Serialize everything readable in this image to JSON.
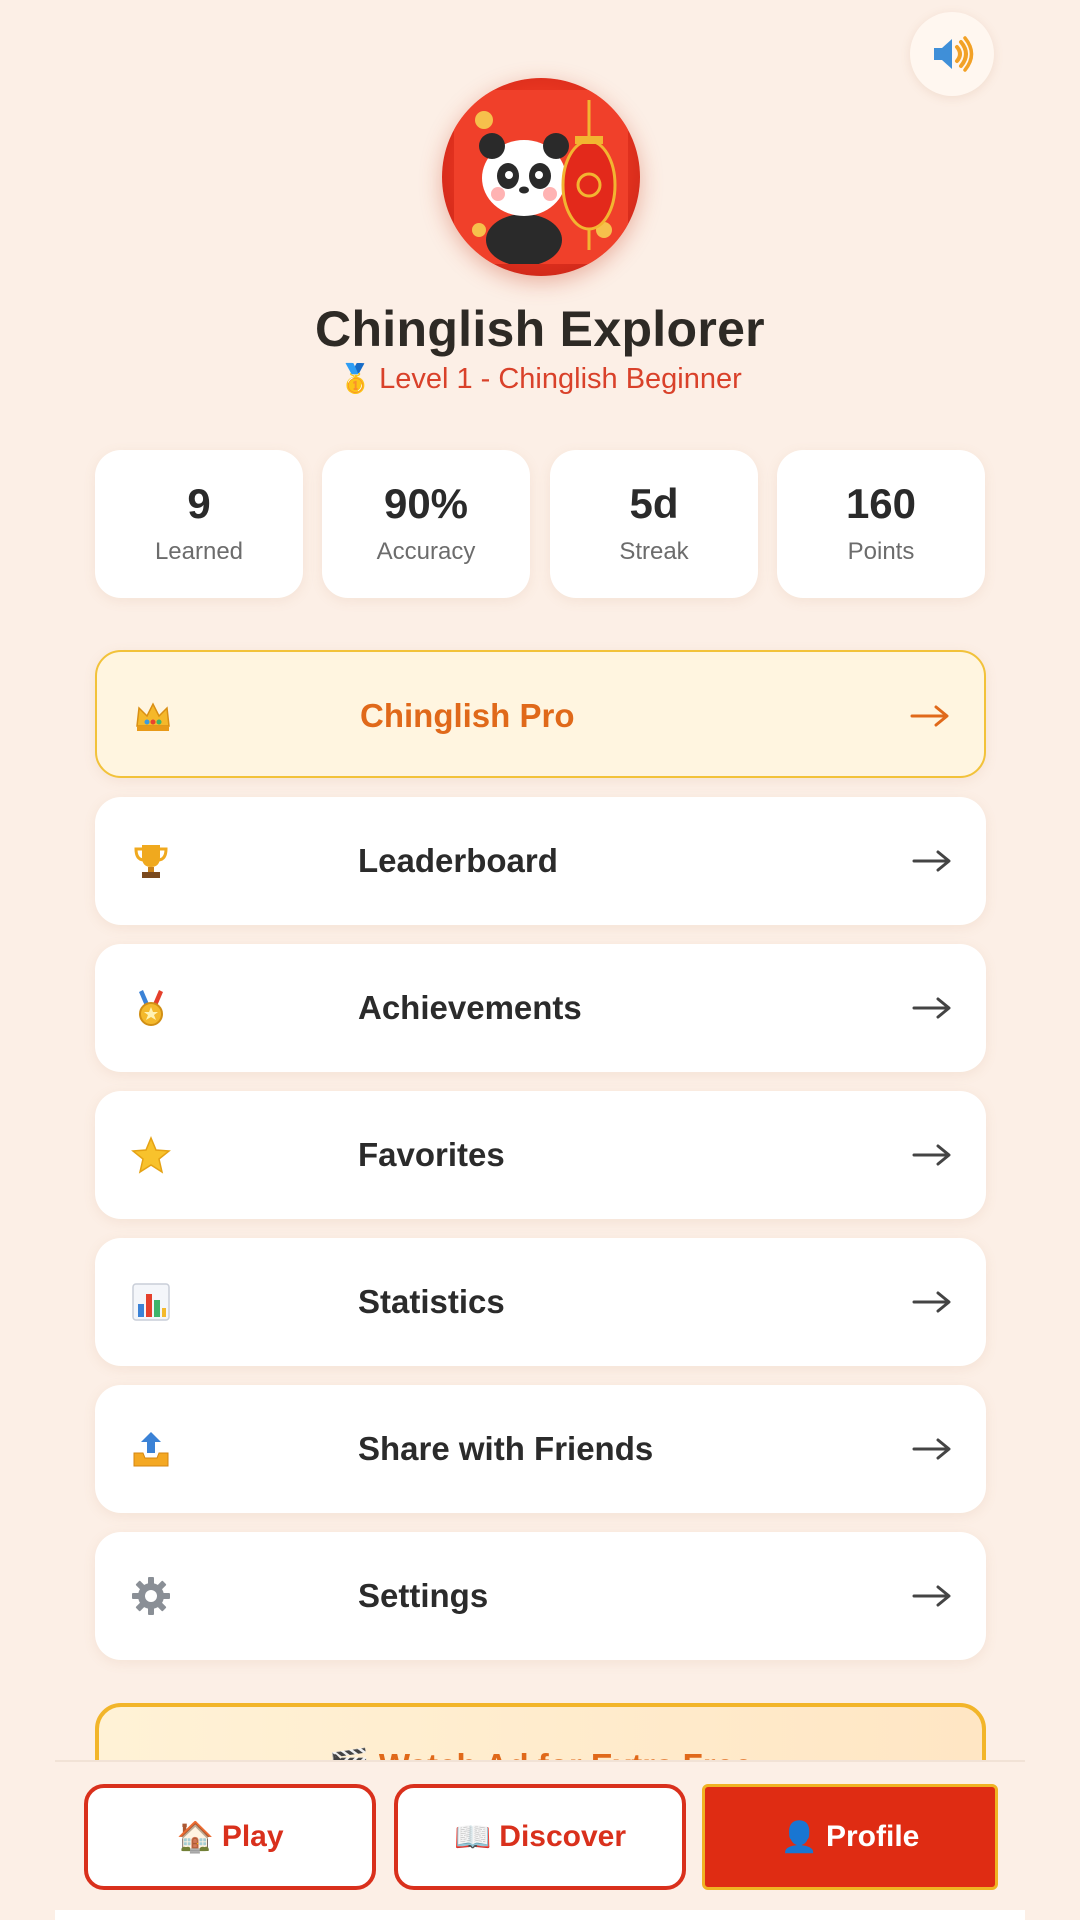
{
  "profile": {
    "name": "Chinglish Explorer",
    "level_icon": "🥇",
    "level": "Level 1 - Chinglish Beginner"
  },
  "stats": [
    {
      "value": "9",
      "label": "Learned"
    },
    {
      "value": "90%",
      "label": "Accuracy"
    },
    {
      "value": "5d",
      "label": "Streak"
    },
    {
      "value": "160",
      "label": "Points"
    }
  ],
  "menu": [
    {
      "icon": "crown-icon",
      "label": "Chinglish Pro"
    },
    {
      "icon": "trophy-icon",
      "label": "Leaderboard"
    },
    {
      "icon": "medal-icon",
      "label": "Achievements"
    },
    {
      "icon": "star-icon",
      "label": "Favorites"
    },
    {
      "icon": "bar-chart-icon",
      "label": "Statistics"
    },
    {
      "icon": "share-tray-icon",
      "label": "Share with Friends"
    },
    {
      "icon": "gear-icon",
      "label": "Settings"
    }
  ],
  "promo": {
    "label": "🎬 Watch Ad for Extra Free"
  },
  "nav": {
    "play": {
      "emoji": "🏠",
      "label": "Play"
    },
    "discover": {
      "emoji": "📖",
      "label": "Discover"
    },
    "profile": {
      "emoji": "👤",
      "label": "Profile"
    }
  },
  "colors": {
    "background": "#fcefe6",
    "accent": "#df2c13",
    "pro_text": "#e0691a",
    "pro_border": "#f2c23a"
  }
}
